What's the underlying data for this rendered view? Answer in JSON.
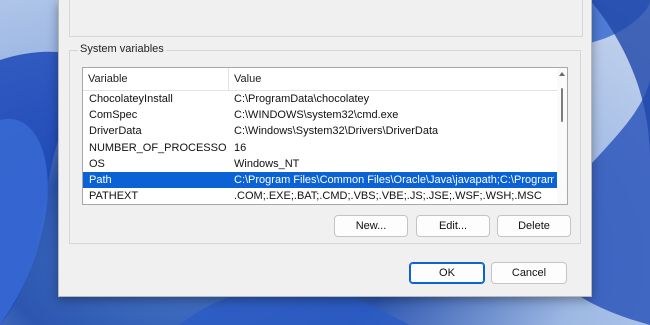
{
  "group_label": "System variables",
  "columns": {
    "variable": "Variable",
    "value": "Value"
  },
  "rows": [
    {
      "variable": "ChocolateyInstall",
      "value": "C:\\ProgramData\\chocolatey"
    },
    {
      "variable": "ComSpec",
      "value": "C:\\WINDOWS\\system32\\cmd.exe"
    },
    {
      "variable": "DriverData",
      "value": "C:\\Windows\\System32\\Drivers\\DriverData"
    },
    {
      "variable": "NUMBER_OF_PROCESSORS",
      "value": "16"
    },
    {
      "variable": "OS",
      "value": "Windows_NT"
    },
    {
      "variable": "Path",
      "value": "C:\\Program Files\\Common Files\\Oracle\\Java\\javapath;C:\\Program ..."
    },
    {
      "variable": "PATHEXT",
      "value": ".COM;.EXE;.BAT;.CMD;.VBS;.VBE;.JS;.JSE;.WSF;.WSH;.MSC"
    }
  ],
  "selected_row": "Path",
  "buttons": {
    "new": "New...",
    "edit": "Edit...",
    "delete": "Delete",
    "ok": "OK",
    "cancel": "Cancel"
  },
  "colors": {
    "selection": "#0a62d4",
    "dialog_bg": "#f0f0f0"
  }
}
